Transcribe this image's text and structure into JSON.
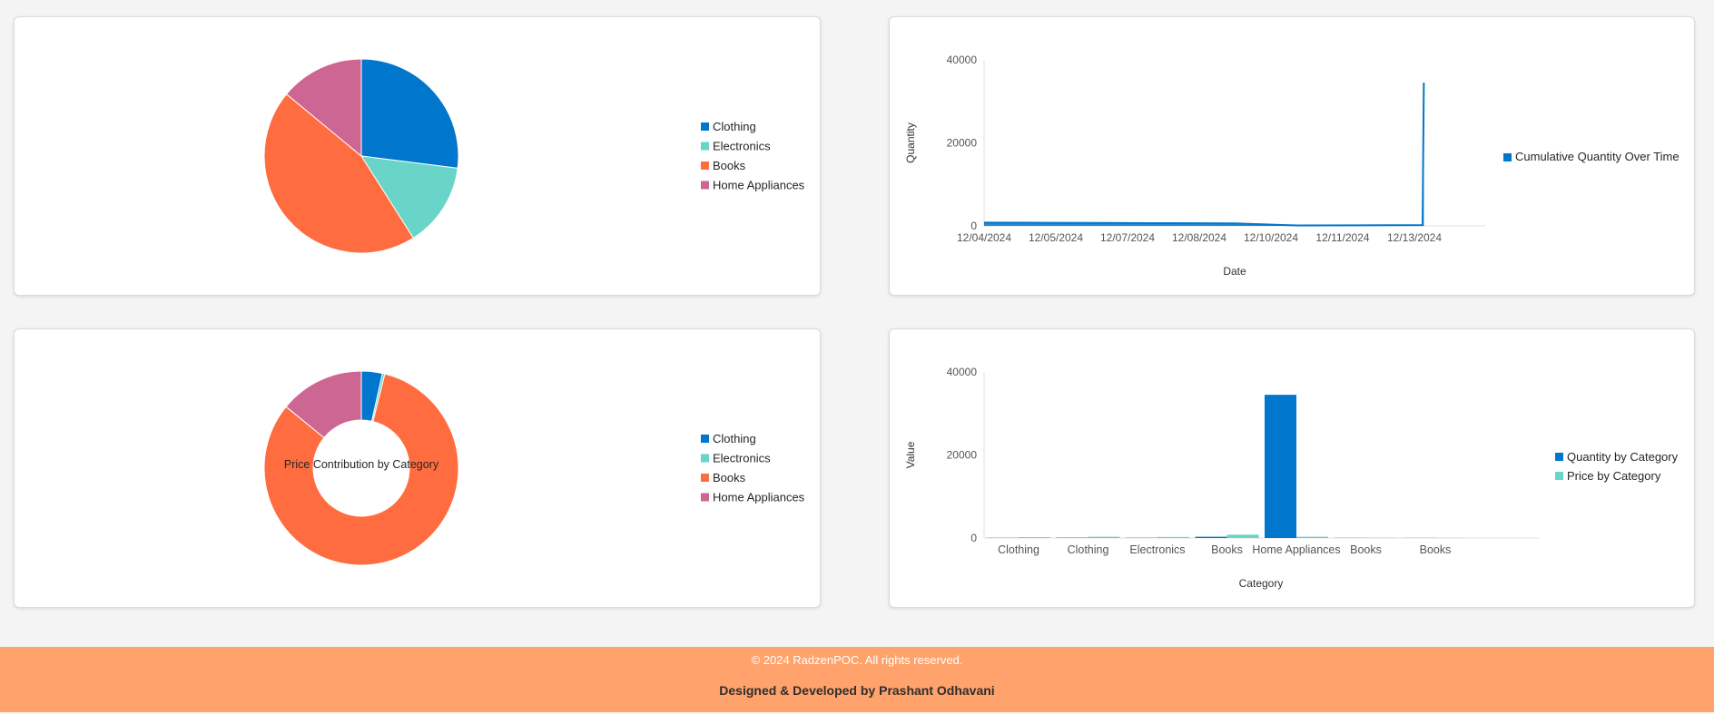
{
  "category_colors": [
    "#0077cc",
    "#68d5c8",
    "#ff6c40",
    "#cd6693"
  ],
  "chart_data": [
    {
      "type": "pie",
      "id": "category-pie",
      "categories": [
        "Clothing",
        "Electronics",
        "Books",
        "Home Appliances"
      ],
      "values": [
        27,
        14,
        45,
        14
      ],
      "legend": [
        "Clothing",
        "Electronics",
        "Books",
        "Home Appliances"
      ],
      "legend_position": "right"
    },
    {
      "type": "area",
      "id": "cumulative-line",
      "xlabel": "Date",
      "ylabel": "Quantity",
      "ylim": [
        0,
        40000
      ],
      "yticks": [
        "0",
        "20000",
        "40000"
      ],
      "x_tick_labels": [
        "12/04/2024",
        "12/05/2024",
        "12/07/2024",
        "12/08/2024",
        "12/10/2024",
        "12/11/2024",
        "12/13/2024"
      ],
      "series": [
        {
          "name": "Cumulative Quantity Over Time",
          "values": [
            800,
            750,
            700,
            650,
            600,
            100,
            150,
            200,
            34500
          ]
        }
      ],
      "legend_position": "right"
    },
    {
      "type": "pie",
      "id": "price-donut",
      "center_label": "Price Contribution by Category",
      "categories": [
        "Clothing",
        "Electronics",
        "Books",
        "Home Appliances"
      ],
      "values": [
        3.5,
        0.4,
        82,
        14.1
      ],
      "legend": [
        "Clothing",
        "Electronics",
        "Books",
        "Home Appliances"
      ],
      "legend_position": "right"
    },
    {
      "type": "bar",
      "id": "category-bar",
      "xlabel": "Category",
      "ylabel": "Value",
      "ylim": [
        0,
        40000
      ],
      "yticks": [
        "0",
        "20000",
        "40000"
      ],
      "categories": [
        "Clothing",
        "Clothing",
        "Electronics",
        "Books",
        "Home Appliances",
        "Books",
        "Books"
      ],
      "series": [
        {
          "name": "Quantity by Category",
          "values": [
            50,
            80,
            60,
            300,
            34500,
            40,
            30
          ]
        },
        {
          "name": "Price by Category",
          "values": [
            200,
            300,
            250,
            800,
            300,
            60,
            40
          ]
        }
      ],
      "legend_position": "right"
    }
  ],
  "footer": {
    "copyright": "© 2024 RadzenPOC. All rights reserved.",
    "credit": "Designed & Developed by Prashant Odhavani"
  }
}
